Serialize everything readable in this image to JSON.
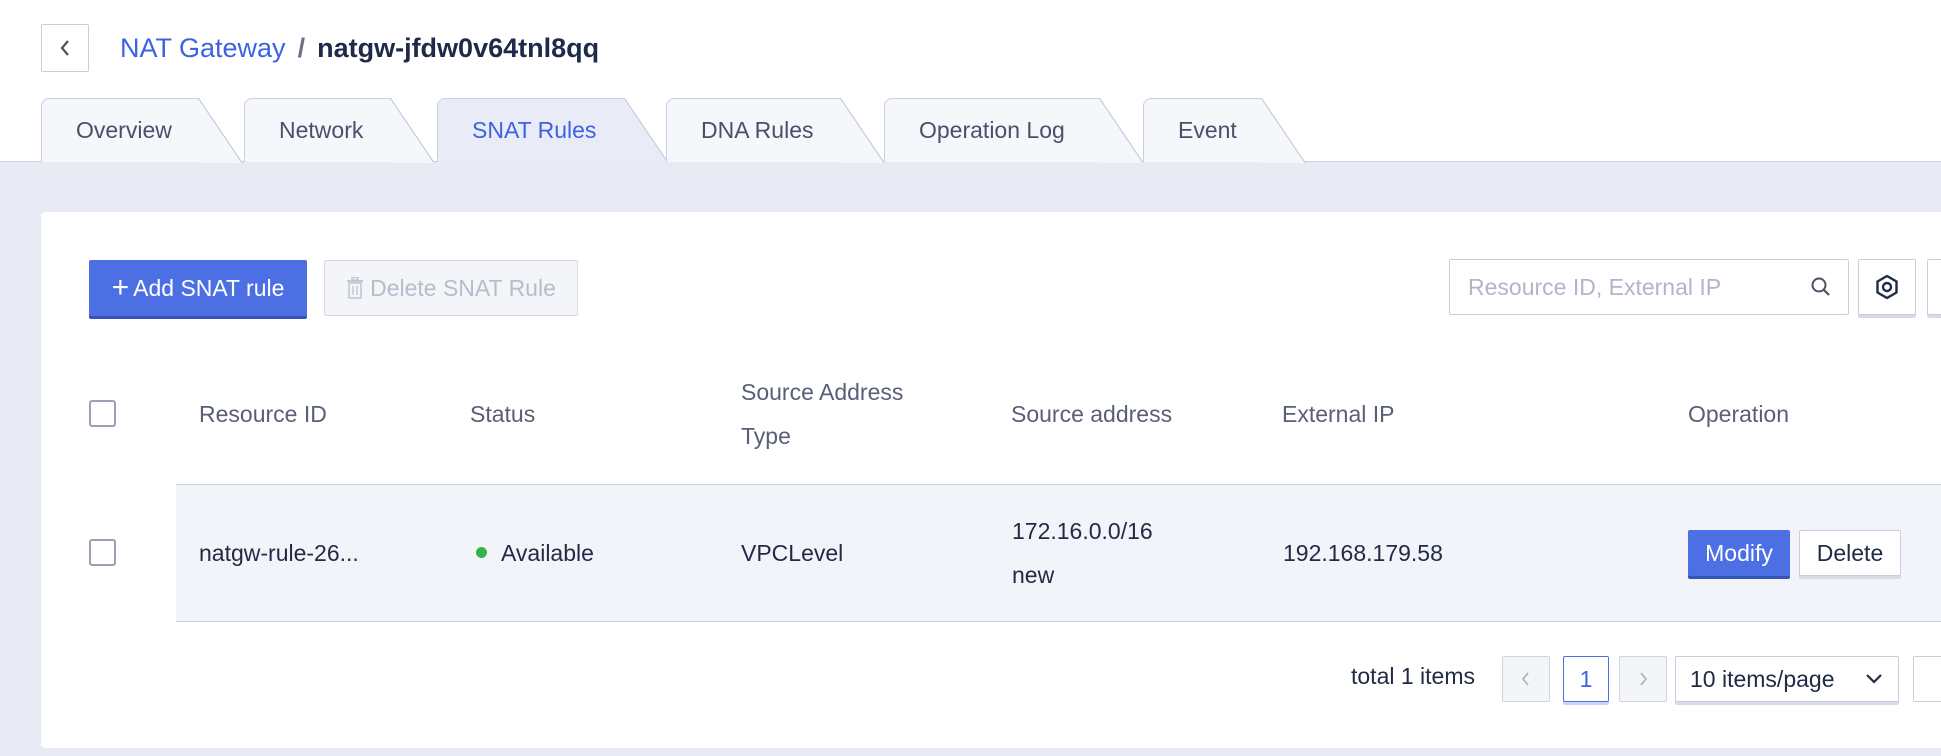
{
  "breadcrumb": {
    "parent": "NAT Gateway",
    "separator": "/",
    "current": "natgw-jfdw0v64tnl8qq"
  },
  "tabs": [
    {
      "label": "Overview",
      "active": false
    },
    {
      "label": "Network",
      "active": false
    },
    {
      "label": "SNAT Rules",
      "active": true
    },
    {
      "label": "DNA Rules",
      "active": false
    },
    {
      "label": "Operation Log",
      "active": false
    },
    {
      "label": "Event",
      "active": false
    }
  ],
  "toolbar": {
    "add_label": "Add SNAT rule",
    "delete_label": "Delete SNAT Rule",
    "search_placeholder": "Resource ID, External IP"
  },
  "table": {
    "headers": {
      "resource_id": "Resource ID",
      "status": "Status",
      "source_type_line1": "Source Address",
      "source_type_line2": "Type",
      "source_address": "Source address",
      "external_ip": "External IP",
      "operation": "Operation"
    },
    "rows": [
      {
        "resource_id": "natgw-rule-26...",
        "status": "Available",
        "source_type": "VPCLevel",
        "source_address_line1": "172.16.0.0/16",
        "source_address_line2": "new",
        "external_ip": "192.168.179.58",
        "modify_label": "Modify",
        "delete_label": "Delete"
      }
    ]
  },
  "pagination": {
    "total_text": "total 1 items",
    "current_page": "1",
    "page_size": "10 items/page"
  },
  "colors": {
    "accent": "#4c6fe3",
    "link": "#3c63e0",
    "status_available": "#33b44a"
  }
}
